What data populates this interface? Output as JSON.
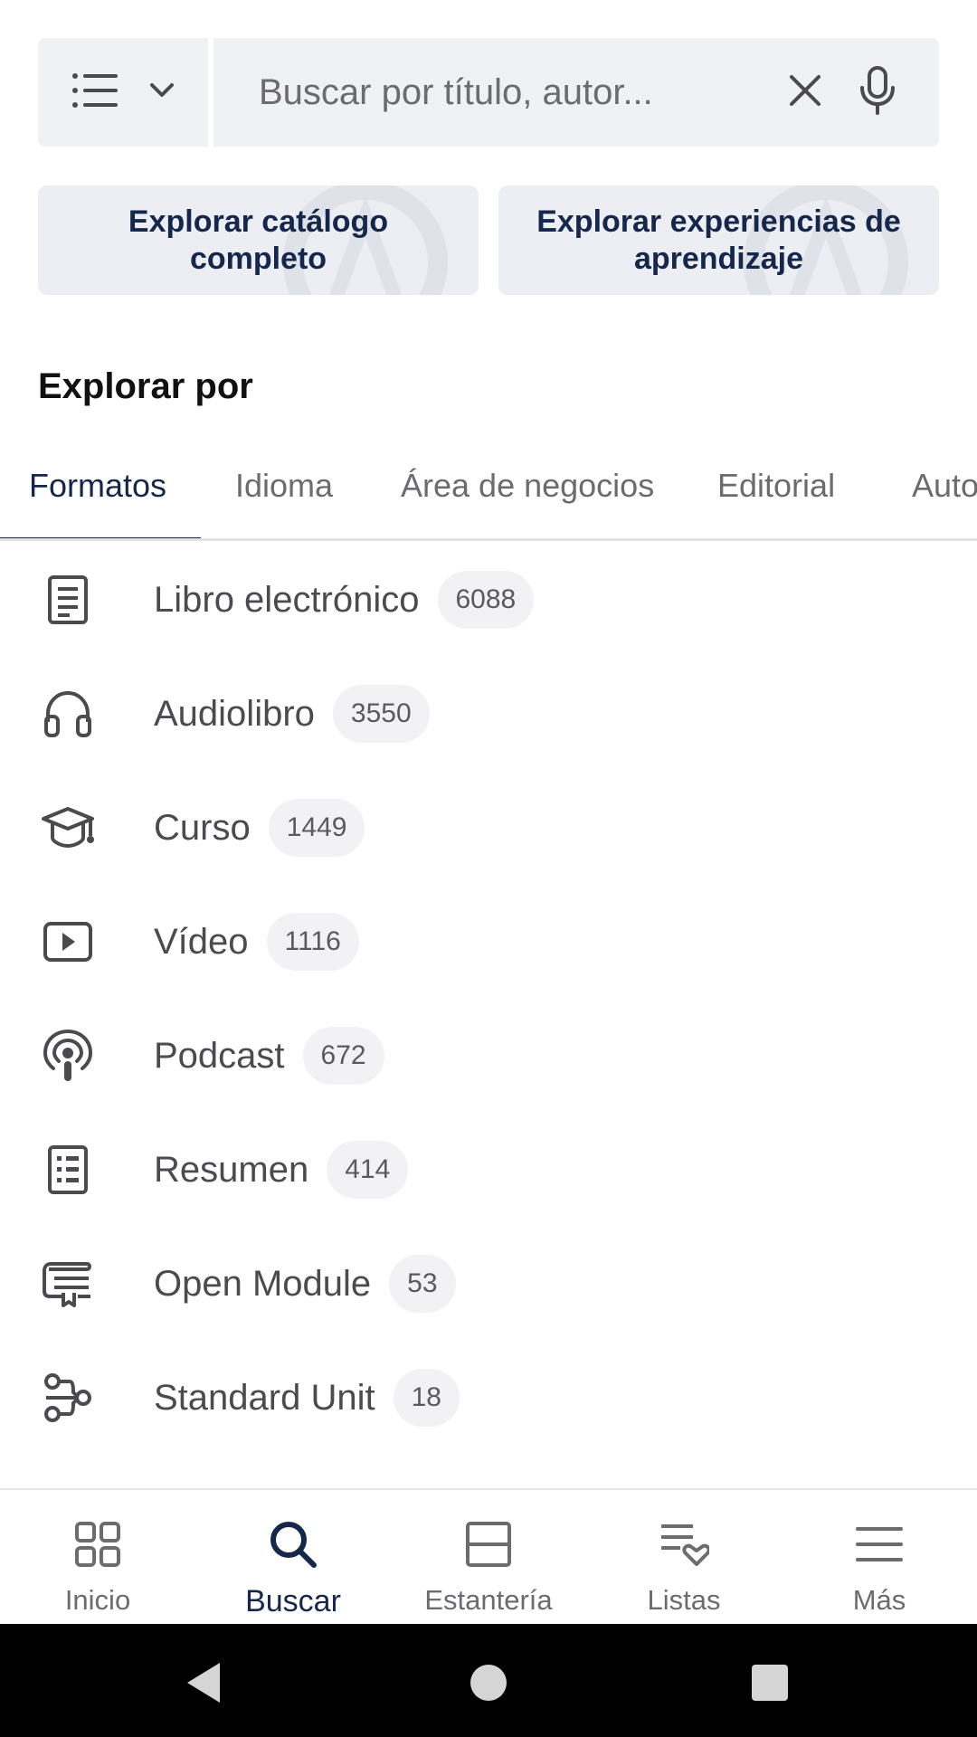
{
  "search": {
    "placeholder": "Buscar por título, autor..."
  },
  "explore_cards": [
    {
      "label": "Explorar catálogo completo"
    },
    {
      "label": "Explorar experiencias de aprendizaje"
    }
  ],
  "section": {
    "title": "Explorar por"
  },
  "tabs": [
    {
      "label": "Formatos",
      "active": true
    },
    {
      "label": "Idioma"
    },
    {
      "label": "Área de negocios"
    },
    {
      "label": "Editorial"
    },
    {
      "label": "Autor"
    }
  ],
  "formats": [
    {
      "label": "Libro electrónico",
      "count": "6088",
      "icon": "ebook-icon"
    },
    {
      "label": "Audiolibro",
      "count": "3550",
      "icon": "headphones-icon"
    },
    {
      "label": "Curso",
      "count": "1449",
      "icon": "graduation-cap-icon"
    },
    {
      "label": "Vídeo",
      "count": "1116",
      "icon": "video-play-icon"
    },
    {
      "label": "Podcast",
      "count": "672",
      "icon": "podcast-icon"
    },
    {
      "label": "Resumen",
      "count": "414",
      "icon": "summary-icon"
    },
    {
      "label": "Open Module",
      "count": "53",
      "icon": "open-module-icon"
    },
    {
      "label": "Standard Unit",
      "count": "18",
      "icon": "standard-unit-icon"
    }
  ],
  "bottom_nav": [
    {
      "label": "Inicio",
      "icon": "grid-icon"
    },
    {
      "label": "Buscar",
      "icon": "search-icon",
      "active": true
    },
    {
      "label": "Estantería",
      "icon": "shelf-icon"
    },
    {
      "label": "Listas",
      "icon": "list-heart-icon"
    },
    {
      "label": "Más",
      "icon": "menu-icon"
    }
  ],
  "colors": {
    "accent": "#15284b",
    "text": "#4a4a4f",
    "surface": "#f0f1f3"
  }
}
